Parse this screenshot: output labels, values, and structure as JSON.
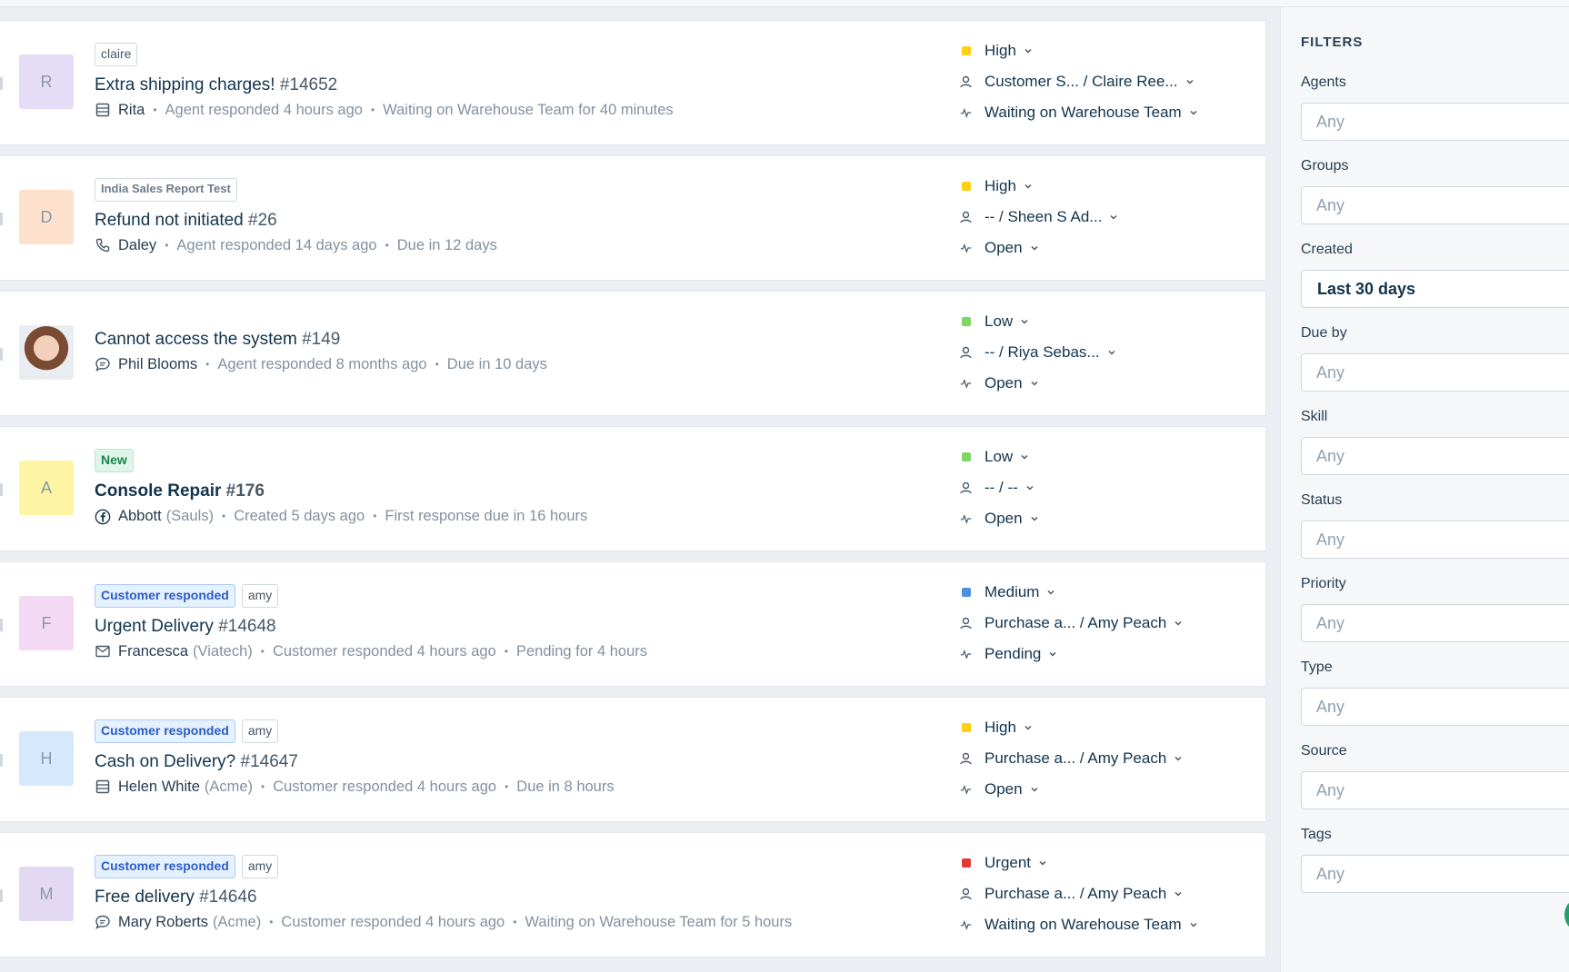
{
  "filters": {
    "title": "FILTERS",
    "fields": [
      {
        "label": "Agents",
        "value": "Any"
      },
      {
        "label": "Groups",
        "value": "Any"
      },
      {
        "label": "Created",
        "value": "Last 30 days"
      },
      {
        "label": "Due by",
        "value": "Any"
      },
      {
        "label": "Skill",
        "value": "Any"
      },
      {
        "label": "Status",
        "value": "Any"
      },
      {
        "label": "Priority",
        "value": "Any"
      },
      {
        "label": "Type",
        "value": "Any"
      },
      {
        "label": "Source",
        "value": "Any"
      },
      {
        "label": "Tags",
        "value": "Any"
      }
    ]
  },
  "tickets": [
    {
      "avatar": "R",
      "avatar_color": "#e5dcf7",
      "tags": [
        {
          "text": "claire",
          "style": "plain"
        }
      ],
      "title": "Extra shipping charges!",
      "number": "#14652",
      "source_icon": "table-icon",
      "requester": "Rita",
      "company": "",
      "activity": "Agent responded 4 hours ago",
      "due": "Waiting on Warehouse Team for 40 minutes",
      "priority": "High",
      "priority_color": "#ffd012",
      "assignee": "Customer S... / Claire Ree...",
      "status": "Waiting on Warehouse Team"
    },
    {
      "avatar": "D",
      "avatar_color": "#fde1cc",
      "tags": [
        {
          "text": "India Sales Report Test",
          "style": "small"
        }
      ],
      "title": "Refund not initiated",
      "number": "#26",
      "source_icon": "phone-icon",
      "requester": "Daley",
      "company": "",
      "activity": "Agent responded 14 days ago",
      "due": "Due in 12 days",
      "priority": "High",
      "priority_color": "#ffd012",
      "assignee": "-- / Sheen S Ad...",
      "status": "Open"
    },
    {
      "avatar": "",
      "avatar_color": "#e9edf1",
      "tags": [],
      "title": "Cannot access the system",
      "number": "#149",
      "source_icon": "chat-icon",
      "requester": "Phil Blooms",
      "company": "",
      "activity": "Agent responded 8 months ago",
      "due": "Due in 10 days",
      "priority": "Low",
      "priority_color": "#7ed664",
      "assignee": "-- / Riya Sebas...",
      "status": "Open"
    },
    {
      "avatar": "A",
      "avatar_color": "#fdf4a4",
      "tags": [
        {
          "text": "New",
          "style": "new"
        }
      ],
      "title": "Console Repair",
      "number": "#176",
      "source_icon": "facebook-icon",
      "requester": "Abbott",
      "company": "(Sauls)",
      "activity": "Created 5 days ago",
      "due": "First response due in 16 hours",
      "priority": "Low",
      "priority_color": "#7ed664",
      "assignee": "-- / --",
      "status": "Open"
    },
    {
      "avatar": "F",
      "avatar_color": "#f4d9f5",
      "tags": [
        {
          "text": "Customer responded",
          "style": "resp"
        },
        {
          "text": "amy",
          "style": "plain"
        }
      ],
      "title": "Urgent Delivery",
      "number": "#14648",
      "source_icon": "email-icon",
      "requester": "Francesca",
      "company": "(Viatech)",
      "activity": "Customer responded 4 hours ago",
      "due": "Pending for 4 hours",
      "priority": "Medium",
      "priority_color": "#4a90e2",
      "assignee": "Purchase a... / Amy Peach",
      "status": "Pending"
    },
    {
      "avatar": "H",
      "avatar_color": "#d6e8fb",
      "tags": [
        {
          "text": "Customer responded",
          "style": "resp"
        },
        {
          "text": "amy",
          "style": "plain"
        }
      ],
      "title": "Cash on Delivery?",
      "number": "#14647",
      "source_icon": "table-icon",
      "requester": "Helen White",
      "company": "(Acme)",
      "activity": "Customer responded 4 hours ago",
      "due": "Due in 8 hours",
      "priority": "High",
      "priority_color": "#ffd012",
      "assignee": "Purchase a... / Amy Peach",
      "status": "Open"
    },
    {
      "avatar": "M",
      "avatar_color": "#e3d9f3",
      "tags": [
        {
          "text": "Customer responded",
          "style": "resp"
        },
        {
          "text": "amy",
          "style": "plain"
        }
      ],
      "title": "Free delivery",
      "number": "#14646",
      "source_icon": "chat-icon",
      "requester": "Mary Roberts",
      "company": "(Acme)",
      "activity": "Customer responded 4 hours ago",
      "due": "Waiting on Warehouse Team for 5 hours",
      "priority": "Urgent",
      "priority_color": "#e53935",
      "assignee": "Purchase a... / Amy Peach",
      "status": "Waiting on Warehouse Team"
    }
  ]
}
